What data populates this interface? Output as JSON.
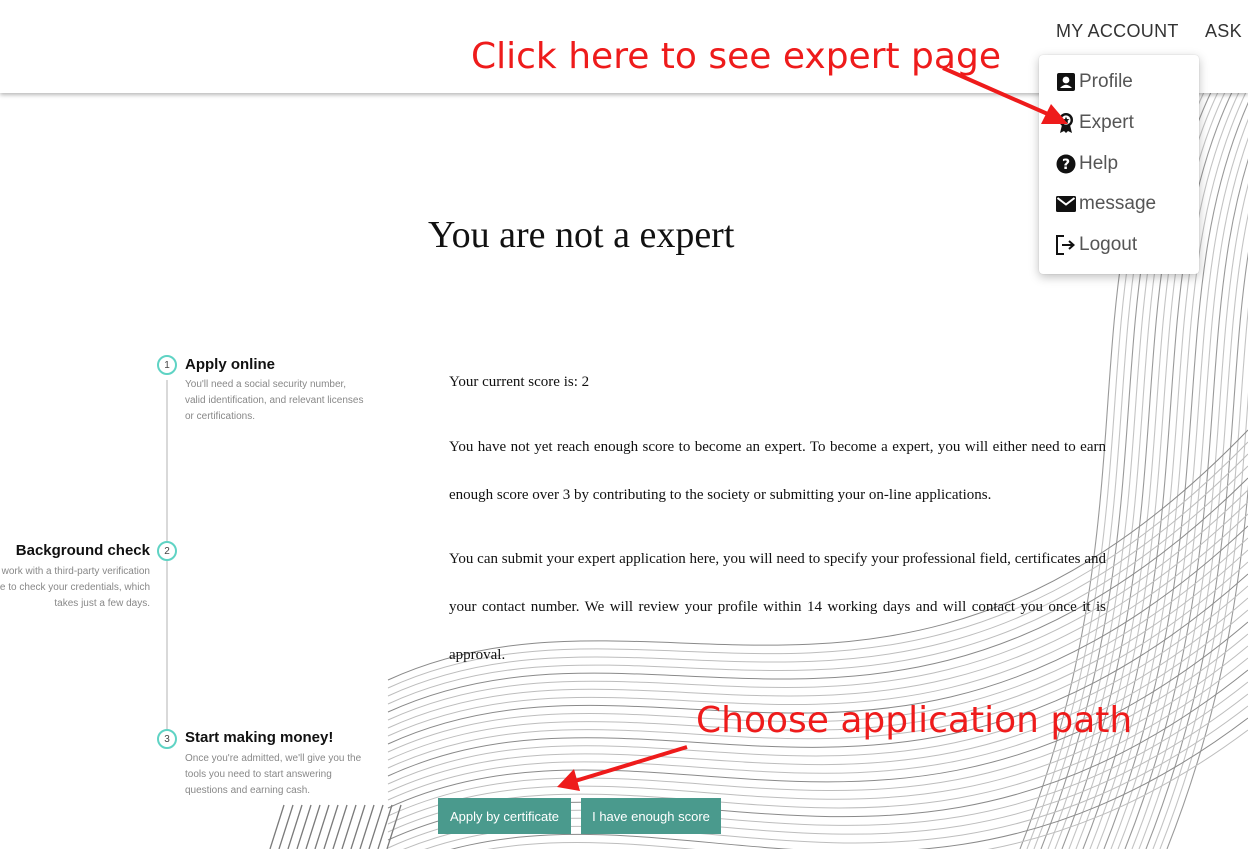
{
  "nav": {
    "my_account": "MY ACCOUNT",
    "ask": "ASK Q"
  },
  "dropdown": {
    "items": [
      {
        "label": "Profile",
        "icon": "account-box-icon"
      },
      {
        "label": "Expert",
        "icon": "award-icon"
      },
      {
        "label": "Help",
        "icon": "help-circle-icon"
      },
      {
        "label": "message",
        "icon": "mail-icon"
      },
      {
        "label": "Logout",
        "icon": "logout-icon"
      }
    ]
  },
  "annotations": {
    "expert_hint": "Click here to see expert page",
    "path_hint": "Choose application path",
    "color": "#ee1b1b"
  },
  "page": {
    "title": "You are not a expert",
    "score_text": "Your current score is: 2",
    "paragraph1": "You have not yet reach enough score to become an expert. To become a expert, you will either need to earn enough score over 3 by contributing to the society or submitting your on-line applications.",
    "paragraph2": "You can submit your expert application here, you will need to specify your professional field, certificates and your contact number. We will review your profile within 14 working days and will contact you once it is approval."
  },
  "steps": [
    {
      "number": "1",
      "title": "Apply online",
      "description": "You'll need a social security number, valid identification, and relevant licenses or certifications."
    },
    {
      "number": "2",
      "title": "Background check",
      "description": "We'll work with a third-party verification service to check your credentials, which takes just a few days."
    },
    {
      "number": "3",
      "title": "Start making money!",
      "description": "Once you're admitted, we'll give you the tools you need to start answering questions and earning cash."
    }
  ],
  "buttons": {
    "certificate": "Apply by certificate",
    "score": "I have enough score",
    "color": "#4a9a8d"
  }
}
